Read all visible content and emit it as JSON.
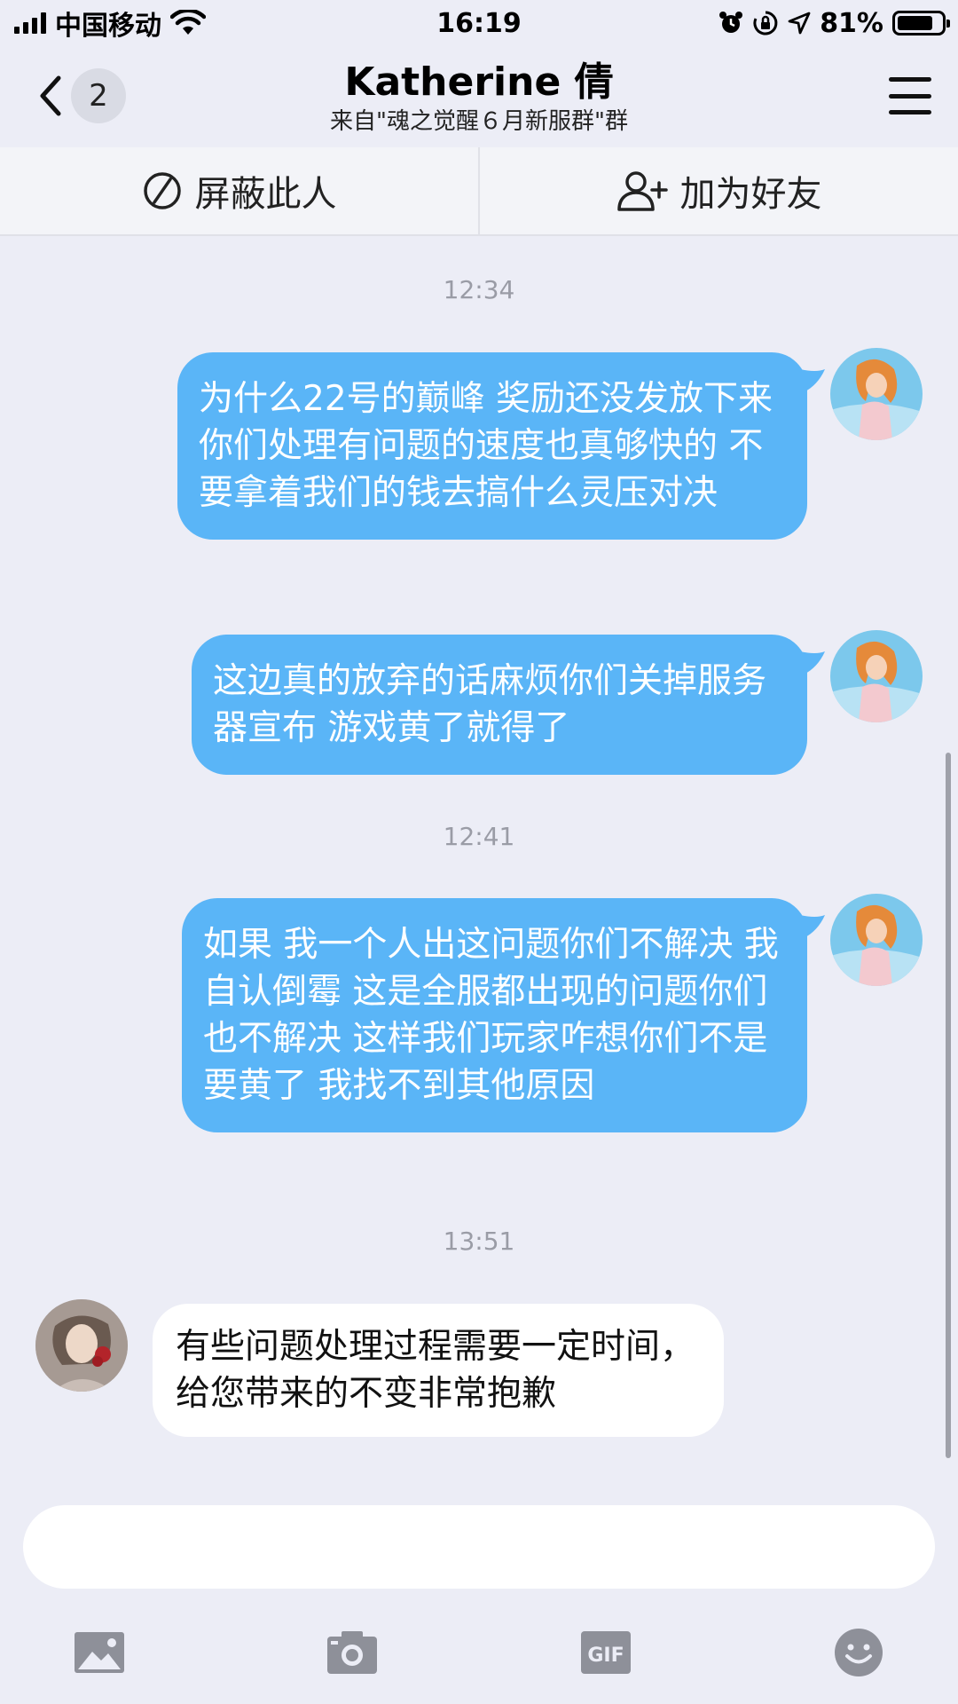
{
  "status_bar": {
    "carrier": "中国移动",
    "time": "16:19",
    "battery": "81%",
    "battery_level": 0.81
  },
  "header": {
    "unread_count": "2",
    "title": "Katherine 倩",
    "subtitle": "来自\"魂之觉醒６月新服群\"群"
  },
  "actions": {
    "block_label": "屏蔽此人",
    "add_friend_label": "加为好友"
  },
  "messages": [
    {
      "type": "time",
      "text": "12:34"
    },
    {
      "type": "outgoing",
      "text": "为什么22号的巅峰 奖励还没发放下来　你们处理有问题的速度也真够快的  不要拿着我们的钱去搞什么灵压对决"
    },
    {
      "type": "outgoing",
      "text": "这边真的放弃的话麻烦你们关掉服务器宣布  游戏黄了就得了"
    },
    {
      "type": "time",
      "text": "12:41"
    },
    {
      "type": "outgoing",
      "text": "如果 我一个人出这问题你们不解决  我自认倒霉  这是全服都出现的问题你们也不解决  这样我们玩家咋想你们不是要黄了  我找不到其他原因"
    },
    {
      "type": "time",
      "text": "13:51"
    },
    {
      "type": "incoming",
      "text": "有些问题处理过程需要一定时间，给您带来的不变非常抱歉"
    }
  ],
  "input": {
    "placeholder": ""
  },
  "toolbar": [
    "image-icon",
    "camera-icon",
    "gif-icon",
    "emoji-icon"
  ],
  "colors": {
    "background": "#ECEDF6",
    "outgoing_bubble": "#5AB5F7",
    "incoming_bubble": "#FFFFFF",
    "icon_gray": "#8E9099"
  }
}
